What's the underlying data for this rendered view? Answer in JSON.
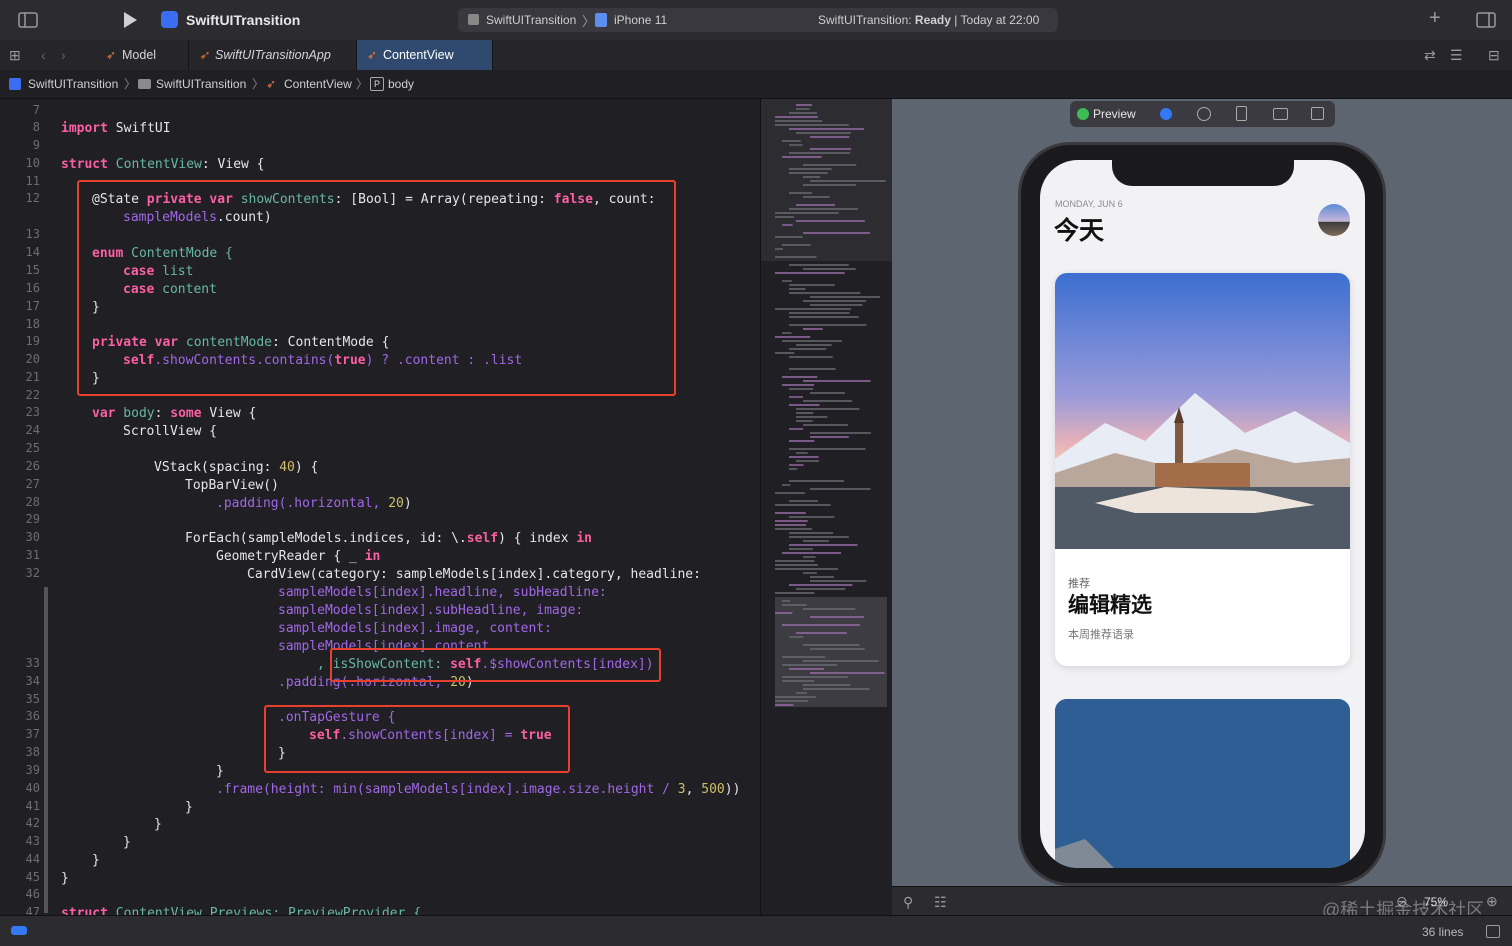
{
  "toolbar": {
    "project_title": "SwiftUITransition",
    "scheme": "SwiftUITransition",
    "device": "iPhone 11",
    "status_prefix": "SwiftUITransition: ",
    "status_state": "Ready",
    "status_time": " | Today at 22:00"
  },
  "tabs": [
    {
      "label": "Model"
    },
    {
      "label": "SwiftUITransitionApp"
    },
    {
      "label": "ContentView"
    }
  ],
  "breadcrumb": [
    "SwiftUITransition",
    "SwiftUITransition",
    "ContentView",
    "body"
  ],
  "line_numbers": [
    "7",
    "8",
    "9",
    "10",
    "11",
    "12",
    "",
    "13",
    "14",
    "15",
    "16",
    "17",
    "18",
    "19",
    "20",
    "21",
    "22",
    "23",
    "24",
    "25",
    "26",
    "27",
    "28",
    "29",
    "30",
    "31",
    "32",
    "",
    "",
    "",
    "",
    "33",
    "34",
    "35",
    "36",
    "37",
    "38",
    "39",
    "40",
    "41",
    "42",
    "43",
    "44",
    "45",
    "46",
    "47"
  ],
  "code": {
    "l8_kw": "import",
    "l8_rest": " SwiftUI",
    "l10_kw": "struct",
    "l10_name": " ContentView",
    "l10_rest": ": View {",
    "l12a": "@State ",
    "l12b": "private var",
    "l12c": " showContents",
    "l12d": ": [Bool] = Array(repeating: ",
    "l12e": "false",
    "l12f": ", count:",
    "l12g": "sampleModels",
    "l12h": ".count)",
    "l14_kw": "enum",
    "l14_rest": " ContentMode {",
    "l15_kw": "case",
    "l15_rest": " list",
    "l16_kw": "case",
    "l16_rest": " content",
    "l17": "}",
    "l19_kw": "private var",
    "l19_name": " contentMode",
    "l19_rest": ": ContentMode {",
    "l20_kw": "self",
    "l20_a": ".showContents.contains(",
    "l20_b": "true",
    "l20_c": ") ? .content : .list",
    "l21": "}",
    "l23_kw": "var",
    "l23_name": " body",
    "l23_a": ": ",
    "l23_b": "some",
    "l23_c": " View {",
    "l24": "ScrollView {",
    "l26_a": "VStack(spacing: ",
    "l26_b": "40",
    "l26_c": ") {",
    "l27": "TopBarView()",
    "l28_a": ".padding(.horizontal, ",
    "l28_b": "20",
    "l28_c": ")",
    "l30_a": "ForEach(sampleModels.indices, id: \\.",
    "l30_b": "self",
    "l30_c": ") { index ",
    "l30_d": "in",
    "l31_a": "GeometryReader { _ ",
    "l31_b": "in",
    "l32_a": "CardView(category: sampleModels[index].category, headline:",
    "l32_b": "sampleModels[index].headline, subHeadline:",
    "l32_c": "sampleModels[index].subHeadline, image:",
    "l32_d": "sampleModels[index].image, content:",
    "l32_e": "sampleModels[index].content",
    "l33_a": ", isShowContent: ",
    "l33_b": "self",
    "l33_c": ".$showContents[index])",
    "l34_a": ".padding(.horizontal, ",
    "l34_b": "20",
    "l34_c": ")",
    "l36": ".onTapGesture {",
    "l37_a": "self",
    "l37_b": ".showContents[index] = ",
    "l37_c": "true",
    "l38": "}",
    "l39": "}",
    "l40_a": ".frame(height: min(sampleModels[index].image.size.height / ",
    "l40_b": "3",
    "l40_c": ", ",
    "l40_d": "500",
    "l40_e": "))",
    "l41": "}",
    "l42": "}",
    "l43": "}",
    "l44": "}",
    "l45": "}",
    "l47_kw": "struct",
    "l47_rest": " ContentView_Previews: PreviewProvider {"
  },
  "preview": {
    "label": "Preview",
    "date": "MONDAY, JUN 6",
    "title": "今天",
    "card_category": "推荐",
    "card_headline": "编辑精选",
    "card_subheadline": "本周推荐语录",
    "zoom": "75%"
  },
  "status": {
    "lines": "36 lines",
    "watermark": "@稀土掘金技术社区"
  },
  "colors": {
    "highlight": "#e8402f",
    "keyword": "#fc5fa3",
    "accent": "#3478f6"
  }
}
